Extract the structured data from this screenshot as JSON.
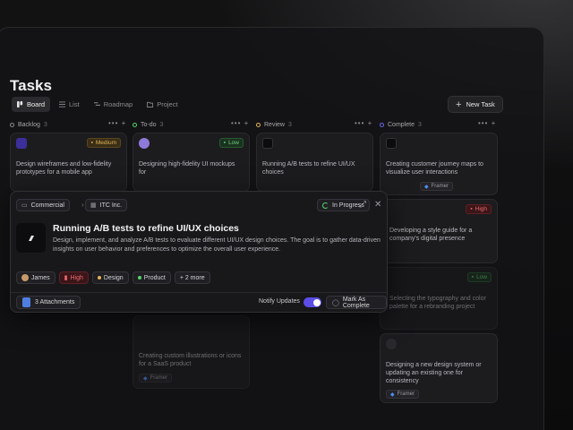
{
  "page": {
    "title": "Tasks"
  },
  "views": [
    "Board",
    "List",
    "Roadmap",
    "Project"
  ],
  "new_task_label": "New Task",
  "columns": [
    {
      "name": "Backlog",
      "count": "3",
      "dot_color": "#8c8c91"
    },
    {
      "name": "To-do",
      "count": "3",
      "dot_color": "#55d46a"
    },
    {
      "name": "Review",
      "count": "3",
      "dot_color": "#e3b356"
    },
    {
      "name": "Complete",
      "count": "3",
      "dot_color": "#6a66ea"
    }
  ],
  "cards": {
    "backlog_1": {
      "priority": "Medium",
      "desc": "Design wireframes and low-fidelity prototypes for a mobile app"
    },
    "todo_1": {
      "priority": "Low",
      "desc": "Designing high-fidelity UI mockups for"
    },
    "review_1": {
      "desc": "Running A/B tests to refine UI/UX choices"
    },
    "complete_1": {
      "desc": "Creating customer journey maps to visualize user interactions",
      "chip": "Framer"
    },
    "complete_2": {
      "priority": "High",
      "desc": "Developing a style guide for a company's digital presence"
    },
    "complete_3": {
      "priority": "Low",
      "desc": "Selecting the typography and color palette for a rebranding project"
    },
    "complete_4": {
      "desc": "Designing a new design system or updating an existing one for consistency",
      "chip": "Framer"
    },
    "todo_3": {
      "desc": "Creating custom illustrations or icons for a SaaS product",
      "chip": "Framer"
    }
  },
  "modal": {
    "breadcrumb_1": "Commercial",
    "breadcrumb_2": "ITC Inc.",
    "status": "In Progress",
    "title": "Running A/B tests to refine UI/UX choices",
    "description": "Design, implement, and analyze A/B tests to evaluate different UI/UX design choices. The goal is to gather data-driven insights on user behavior and preferences to optimize the overall user experience.",
    "tags": {
      "assignee": "James",
      "priority": "High",
      "tag1": "Design",
      "tag2": "Product",
      "more": "+ 2 more"
    },
    "attachments": "3 Attachments",
    "notify_label": "Notify Updates",
    "notify_on": true,
    "complete_label": "Mark As Complete"
  }
}
